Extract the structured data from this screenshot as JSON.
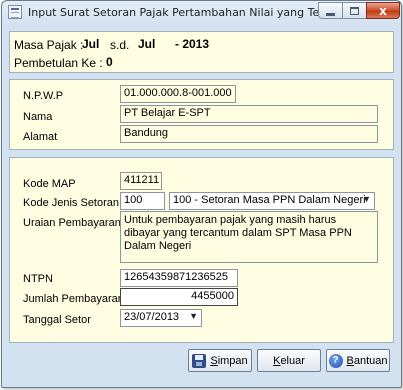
{
  "window": {
    "title": "Input Surat Setoran Pajak Pertambahan Nilai yang Telah...",
    "close_glyph": "x"
  },
  "period": {
    "masa_pajak_label": "Masa Pajak :",
    "month_from": "Jul",
    "separator": "s.d.",
    "month_to": "Jul",
    "year": "- 2013",
    "pembetulan_label": "Pembetulan Ke :",
    "pembetulan_value": "0"
  },
  "taxpayer": {
    "npwp_label": "N.P.W.P",
    "npwp_value": "01.000.000.8-001.000",
    "nama_label": "Nama",
    "nama_value": "PT Belajar E-SPT",
    "alamat_label": "Alamat",
    "alamat_value": "Bandung"
  },
  "payment": {
    "kode_map_label": "Kode MAP",
    "kode_map_value": "411211",
    "kode_jenis_label": "Kode Jenis Setoran",
    "kode_jenis_value": "100",
    "jenis_setoran_selected": "100 - Setoran Masa PPN Dalam Negeri",
    "uraian_label": "Uraian Pembayaran",
    "uraian_value": "Untuk pembayaran pajak yang masih harus dibayar yang tercantum dalam SPT Masa PPN Dalam Negeri",
    "ntpn_label": "NTPN",
    "ntpn_value": "12654359871236525",
    "jumlah_label": "Jumlah Pembayaran",
    "jumlah_value": "4455000",
    "tanggal_label": "Tanggal Setor",
    "tanggal_value": "23/07/2013"
  },
  "buttons": {
    "simpan_underlined": "S",
    "simpan_rest": "impan",
    "keluar_underlined": "K",
    "keluar_rest": "eluar",
    "bantuan_underlined": "B",
    "bantuan_rest": "antuan"
  },
  "icons": {
    "app": "document-icon",
    "save": "floppy-disk-icon",
    "help": "help-icon"
  }
}
